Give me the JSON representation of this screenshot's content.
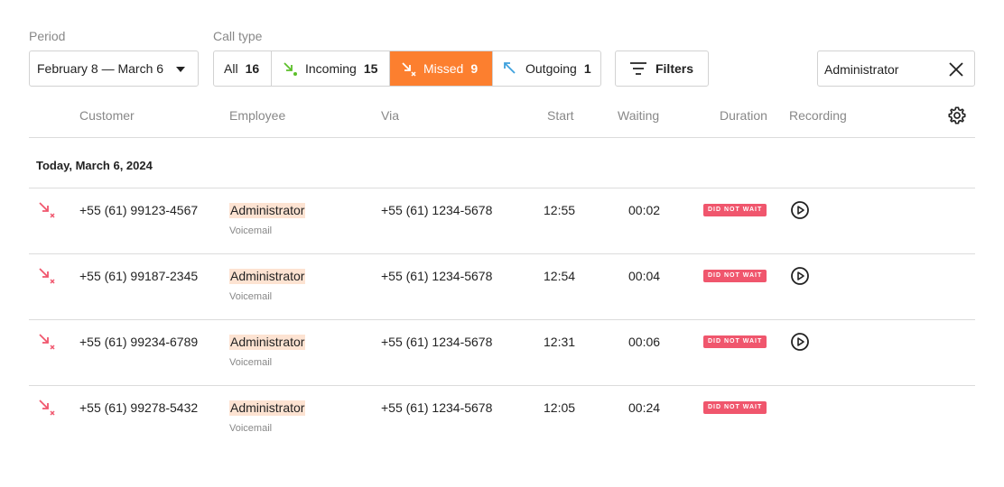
{
  "filters": {
    "period_label": "Period",
    "period_value": "February 8 — March 6",
    "call_type_label": "Call type",
    "call_types": [
      {
        "label": "All",
        "count": "16"
      },
      {
        "label": "Incoming",
        "count": "15"
      },
      {
        "label": "Missed",
        "count": "9"
      },
      {
        "label": "Outgoing",
        "count": "1"
      }
    ],
    "filters_button": "Filters",
    "search_value": "Administrator"
  },
  "columns": {
    "customer": "Customer",
    "employee": "Employee",
    "via": "Via",
    "start": "Start",
    "waiting": "Waiting",
    "duration": "Duration",
    "recording": "Recording"
  },
  "group": {
    "title": "Today, March 6, 2024"
  },
  "rows": [
    {
      "customer": "+55 (61) 99123-4567",
      "employee": "Administrator",
      "sub": "Voicemail",
      "via": "+55 (61) 1234-5678",
      "start": "12:55",
      "waiting": "00:02",
      "status": "DID NOT WAIT"
    },
    {
      "customer": "+55 (61) 99187-2345",
      "employee": "Administrator",
      "sub": "Voicemail",
      "via": "+55 (61) 1234-5678",
      "start": "12:54",
      "waiting": "00:04",
      "status": "DID NOT WAIT"
    },
    {
      "customer": "+55 (61) 99234-6789",
      "employee": "Administrator",
      "sub": "Voicemail",
      "via": "+55 (61) 1234-5678",
      "start": "12:31",
      "waiting": "00:06",
      "status": "DID NOT WAIT"
    },
    {
      "customer": "+55 (61) 99278-5432",
      "employee": "Administrator",
      "sub": "Voicemail",
      "via": "+55 (61) 1234-5678",
      "start": "12:05",
      "waiting": "00:24",
      "status": "DID NOT WAIT"
    }
  ],
  "colors": {
    "accent": "#fc7f2f",
    "missed": "#f0566d",
    "incoming": "#5cbf2a",
    "outgoing": "#3ea1dd",
    "highlight": "#fde3d2"
  }
}
